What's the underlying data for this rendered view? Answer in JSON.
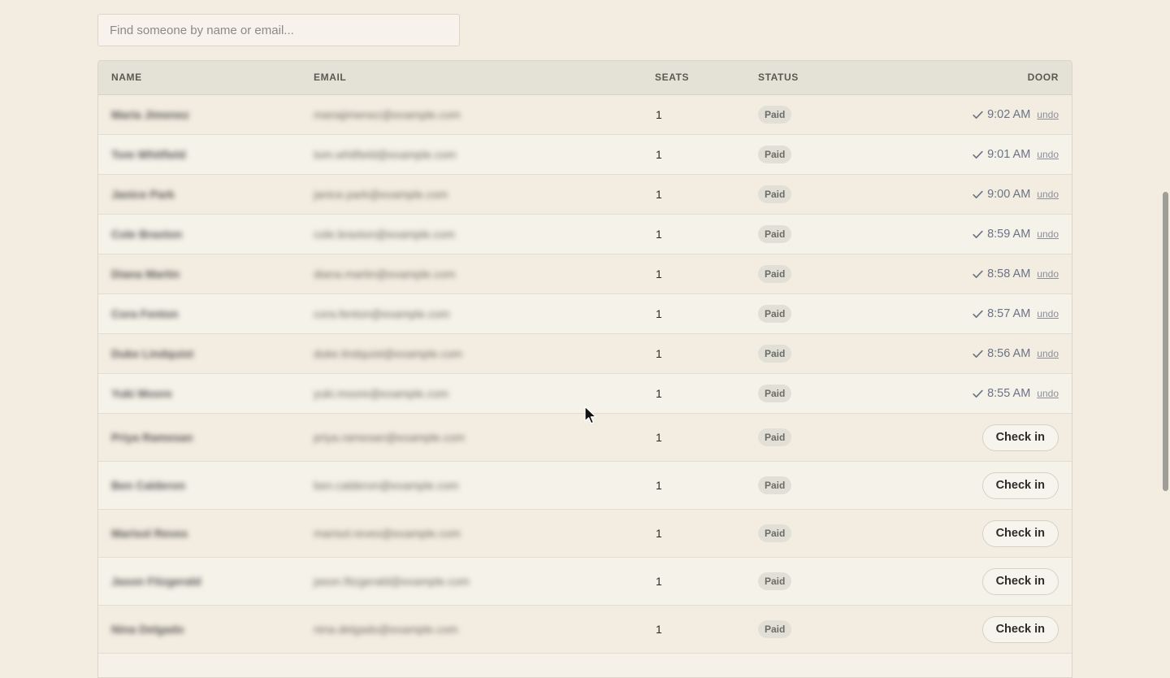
{
  "search": {
    "placeholder": "Find someone by name or email..."
  },
  "table": {
    "headers": {
      "name": "NAME",
      "email": "EMAIL",
      "seats": "SEATS",
      "status": "STATUS",
      "door": "DOOR"
    },
    "rows": [
      {
        "name": "Maria Jimenez",
        "email": "mariajimenez@example.com",
        "seats": "1",
        "status": "Paid",
        "checked": true,
        "time": "9:02 AM",
        "undo": "undo"
      },
      {
        "name": "Tom Whitfield",
        "email": "tom.whitfield@example.com",
        "seats": "1",
        "status": "Paid",
        "checked": true,
        "time": "9:01 AM",
        "undo": "undo"
      },
      {
        "name": "Janice Park",
        "email": "janice.park@example.com",
        "seats": "1",
        "status": "Paid",
        "checked": true,
        "time": "9:00 AM",
        "undo": "undo"
      },
      {
        "name": "Cole Braxton",
        "email": "cole.braxton@example.com",
        "seats": "1",
        "status": "Paid",
        "checked": true,
        "time": "8:59 AM",
        "undo": "undo"
      },
      {
        "name": "Diana Martin",
        "email": "diana.martin@example.com",
        "seats": "1",
        "status": "Paid",
        "checked": true,
        "time": "8:58 AM",
        "undo": "undo"
      },
      {
        "name": "Cora Fenton",
        "email": "cora.fenton@example.com",
        "seats": "1",
        "status": "Paid",
        "checked": true,
        "time": "8:57 AM",
        "undo": "undo"
      },
      {
        "name": "Duke Lindquist",
        "email": "duke.lindquist@example.com",
        "seats": "1",
        "status": "Paid",
        "checked": true,
        "time": "8:56 AM",
        "undo": "undo"
      },
      {
        "name": "Yuki Moore",
        "email": "yuki.moore@example.com",
        "seats": "1",
        "status": "Paid",
        "checked": true,
        "time": "8:55 AM",
        "undo": "undo"
      },
      {
        "name": "Priya Ramesan",
        "email": "priya.ramesan@example.com",
        "seats": "1",
        "status": "Paid",
        "checked": false,
        "button": "Check in"
      },
      {
        "name": "Ben Calderon",
        "email": "ben.calderon@example.com",
        "seats": "1",
        "status": "Paid",
        "checked": false,
        "button": "Check in"
      },
      {
        "name": "Marisol Reves",
        "email": "marisol.reves@example.com",
        "seats": "1",
        "status": "Paid",
        "checked": false,
        "button": "Check in"
      },
      {
        "name": "Jason Fitzgerald",
        "email": "jason.fitzgerald@example.com",
        "seats": "1",
        "status": "Paid",
        "checked": false,
        "button": "Check in"
      },
      {
        "name": "Nina Delgado",
        "email": "nina.delgado@example.com",
        "seats": "1",
        "status": "Paid",
        "checked": false,
        "button": "Check in"
      }
    ]
  },
  "icons": {
    "check": "checkmark-icon",
    "cursor": "mouse-pointer-icon"
  },
  "colors": {
    "background": "#f3ece0",
    "checked_time": "#6a7486"
  }
}
